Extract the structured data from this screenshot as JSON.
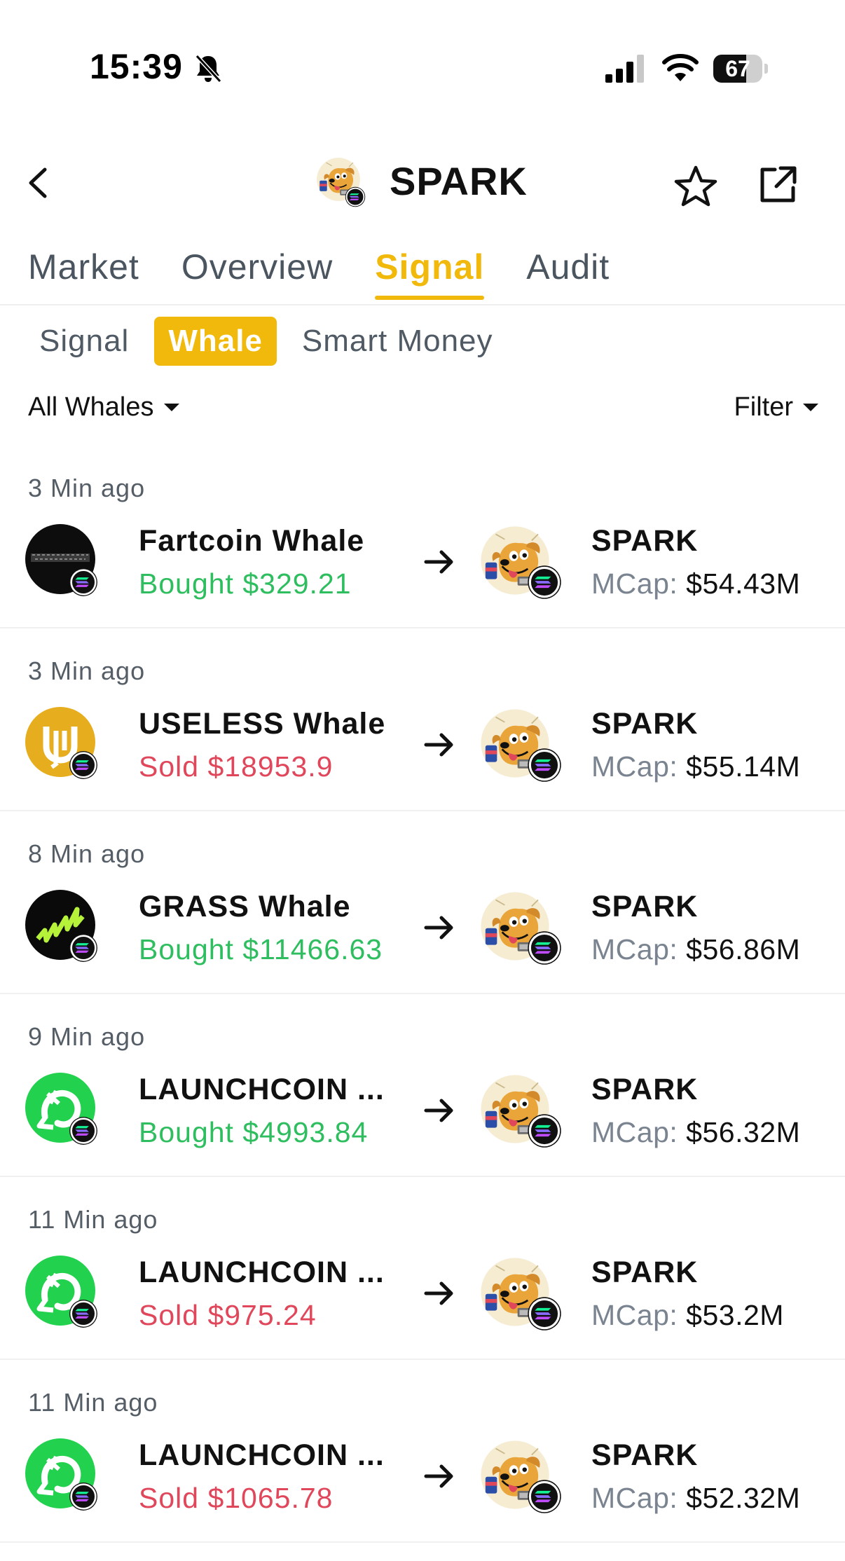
{
  "status_bar": {
    "time": "15:39",
    "battery": "67",
    "battery_level": 0.67,
    "icons": [
      "bell-slash-icon",
      "cellular-signal-icon",
      "wifi-icon",
      "battery-icon"
    ]
  },
  "header": {
    "title": "SPARK",
    "icons": [
      "back-chevron-icon",
      "star-icon",
      "share-icon"
    ]
  },
  "main_tabs": [
    {
      "label": "Market"
    },
    {
      "label": "Overview"
    },
    {
      "label": "Signal"
    },
    {
      "label": "Audit"
    }
  ],
  "active_main_tab": "Signal",
  "sub_tabs": [
    {
      "label": "Signal"
    },
    {
      "label": "Whale"
    },
    {
      "label": "Smart Money"
    }
  ],
  "active_sub_tab": "Whale",
  "filters": {
    "all_whales": "All Whales",
    "filter": "Filter"
  },
  "colors": {
    "accent": "#f0b90b",
    "buy": "#2ebd5f",
    "sell": "#e0475b"
  },
  "feed": [
    {
      "time": "3 Min ago",
      "whale": "Fartcoin  Whale",
      "trade": "Bought $329.21",
      "side": "buy",
      "token": "SPARK",
      "mcap_label": "MCap:",
      "mcap": "$54.43M",
      "avatar": "fartcoin-avatar"
    },
    {
      "time": "3 Min ago",
      "whale": "USELESS Whale",
      "trade": "Sold  $18953.9",
      "side": "sell",
      "token": "SPARK",
      "mcap_label": "MCap:",
      "mcap": "$55.14M",
      "avatar": "useless-avatar"
    },
    {
      "time": "8 Min ago",
      "whale": "GRASS Whale",
      "trade": "Bought $11466.63",
      "side": "buy",
      "token": "SPARK",
      "mcap_label": "MCap:",
      "mcap": "$56.86M",
      "avatar": "grass-avatar"
    },
    {
      "time": "9 Min ago",
      "whale": "LAUNCHCOIN ...",
      "trade": "Bought $4993.84",
      "side": "buy",
      "token": "SPARK",
      "mcap_label": "MCap:",
      "mcap": "$56.32M",
      "avatar": "launchcoin-avatar"
    },
    {
      "time": "11 Min ago",
      "whale": "LAUNCHCOIN ...",
      "trade": "Sold  $975.24",
      "side": "sell",
      "token": "SPARK",
      "mcap_label": "MCap:",
      "mcap": "$53.2M",
      "avatar": "launchcoin-avatar"
    },
    {
      "time": "11 Min ago",
      "whale": "LAUNCHCOIN ...",
      "trade": "Sold  $1065.78",
      "side": "sell",
      "token": "SPARK",
      "mcap_label": "MCap:",
      "mcap": "$52.32M",
      "avatar": "launchcoin-avatar"
    }
  ]
}
